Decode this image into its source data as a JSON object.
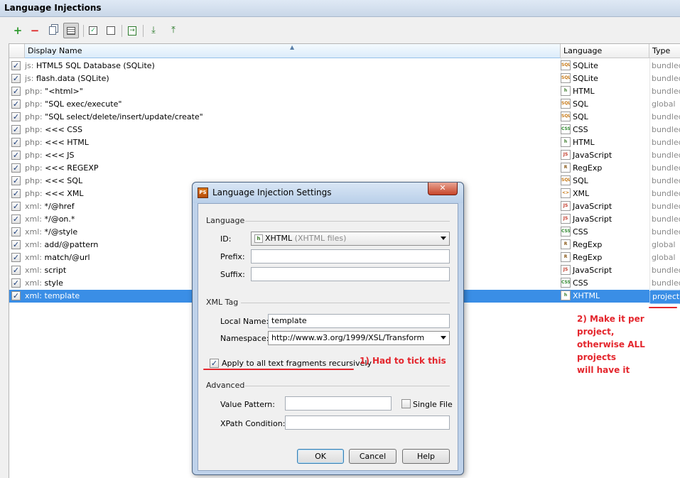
{
  "panel": {
    "title": "Language Injections"
  },
  "toolbar": {
    "buttons": [
      {
        "name": "add-icon",
        "glyph": "+"
      },
      {
        "name": "remove-icon",
        "glyph": "−"
      },
      {
        "name": "copy-icon"
      },
      {
        "name": "edit-list-icon"
      },
      {
        "name": "enable-selected-icon"
      },
      {
        "name": "disable-selected-icon"
      },
      {
        "name": "move-to-project-icon"
      },
      {
        "name": "import-icon"
      },
      {
        "name": "export-icon"
      }
    ]
  },
  "table": {
    "columns": {
      "display_name": "Display Name",
      "language": "Language",
      "type": "Type"
    },
    "rows": [
      {
        "checked": true,
        "prefix": "js:",
        "name": "HTML5 SQL Database (SQLite)",
        "language": "SQLite",
        "icon": "SQL",
        "icon_color": "#c77a18",
        "type": "bundled"
      },
      {
        "checked": true,
        "prefix": "js:",
        "name": "flash.data (SQLite)",
        "language": "SQLite",
        "icon": "SQL",
        "icon_color": "#c77a18",
        "type": "bundled"
      },
      {
        "checked": true,
        "prefix": "php:",
        "name": "\"<html>\"",
        "language": "HTML",
        "icon": "h",
        "icon_color": "#3a7a2a",
        "type": "bundled"
      },
      {
        "checked": true,
        "prefix": "php:",
        "name": "\"SQL exec/execute\"",
        "language": "SQL",
        "icon": "SQL",
        "icon_color": "#c77a18",
        "type": "global"
      },
      {
        "checked": true,
        "prefix": "php:",
        "name": "\"SQL select/delete/insert/update/create\"",
        "language": "SQL",
        "icon": "SQL",
        "icon_color": "#c77a18",
        "type": "bundled"
      },
      {
        "checked": true,
        "prefix": "php:",
        "name": "<<< CSS",
        "language": "CSS",
        "icon": "CSS",
        "icon_color": "#2f8a2f",
        "type": "bundled"
      },
      {
        "checked": true,
        "prefix": "php:",
        "name": "<<< HTML",
        "language": "HTML",
        "icon": "h",
        "icon_color": "#3a7a2a",
        "type": "bundled"
      },
      {
        "checked": true,
        "prefix": "php:",
        "name": "<<< JS",
        "language": "JavaScript",
        "icon": "JS",
        "icon_color": "#c23a2a",
        "type": "bundled"
      },
      {
        "checked": true,
        "prefix": "php:",
        "name": "<<< REGEXP",
        "language": "RegExp",
        "icon": "R",
        "icon_color": "#8a5a1a",
        "type": "bundled"
      },
      {
        "checked": true,
        "prefix": "php:",
        "name": "<<< SQL",
        "language": "SQL",
        "icon": "SQL",
        "icon_color": "#c77a18",
        "type": "bundled"
      },
      {
        "checked": true,
        "prefix": "php:",
        "name": "<<< XML",
        "language": "XML",
        "icon": "<>",
        "icon_color": "#c77a18",
        "type": "bundled"
      },
      {
        "checked": true,
        "prefix": "xml:",
        "name": "*/@href",
        "language": "JavaScript",
        "icon": "JS",
        "icon_color": "#c23a2a",
        "type": "bundled"
      },
      {
        "checked": true,
        "prefix": "xml:",
        "name": "*/@on.*",
        "language": "JavaScript",
        "icon": "JS",
        "icon_color": "#c23a2a",
        "type": "bundled"
      },
      {
        "checked": true,
        "prefix": "xml:",
        "name": "*/@style",
        "language": "CSS",
        "icon": "CSS",
        "icon_color": "#2f8a2f",
        "type": "bundled"
      },
      {
        "checked": true,
        "prefix": "xml:",
        "name": "add/@pattern",
        "language": "RegExp",
        "icon": "R",
        "icon_color": "#8a5a1a",
        "type": "global"
      },
      {
        "checked": true,
        "prefix": "xml:",
        "name": "match/@url",
        "language": "RegExp",
        "icon": "R",
        "icon_color": "#8a5a1a",
        "type": "global"
      },
      {
        "checked": true,
        "prefix": "xml:",
        "name": "script",
        "language": "JavaScript",
        "icon": "JS",
        "icon_color": "#c23a2a",
        "type": "bundled"
      },
      {
        "checked": true,
        "prefix": "xml:",
        "name": "style",
        "language": "CSS",
        "icon": "CSS",
        "icon_color": "#2f8a2f",
        "type": "bundled"
      },
      {
        "checked": true,
        "prefix": "xml:",
        "name": "template",
        "language": "XHTML",
        "icon": "h",
        "icon_color": "#3a7a2a",
        "type": "project",
        "selected": true
      }
    ]
  },
  "dialog": {
    "title": "Language Injection Settings",
    "close_glyph": "✕",
    "language_section": "Language",
    "id_label": "ID:",
    "id_value": "XHTML",
    "id_hint": "(XHTML files)",
    "prefix_label": "Prefix:",
    "prefix_value": "",
    "suffix_label": "Suffix:",
    "suffix_value": "",
    "xml_tag_section": "XML Tag",
    "local_name_label": "Local Name:",
    "local_name_value": "template",
    "namespace_label": "Namespace:",
    "namespace_value": "http://www.w3.org/1999/XSL/Transform",
    "apply_recursive_label": "Apply to all text fragments recursively",
    "apply_recursive_checked": true,
    "advanced_section": "Advanced",
    "value_pattern_label": "Value Pattern:",
    "value_pattern_value": "",
    "single_file_label": "Single File",
    "single_file_checked": false,
    "xpath_label": "XPath Condition:",
    "xpath_value": "",
    "ok_label": "OK",
    "cancel_label": "Cancel",
    "help_label": "Help"
  },
  "annotations": {
    "note1": "1) Had to tick this",
    "note2_line1": "2) Make it per project,",
    "note2_line2": "otherwise ALL projects",
    "note2_line3": "will have it"
  },
  "colors": {
    "selection": "#3a8ee6",
    "annotation": "#e4262d"
  }
}
